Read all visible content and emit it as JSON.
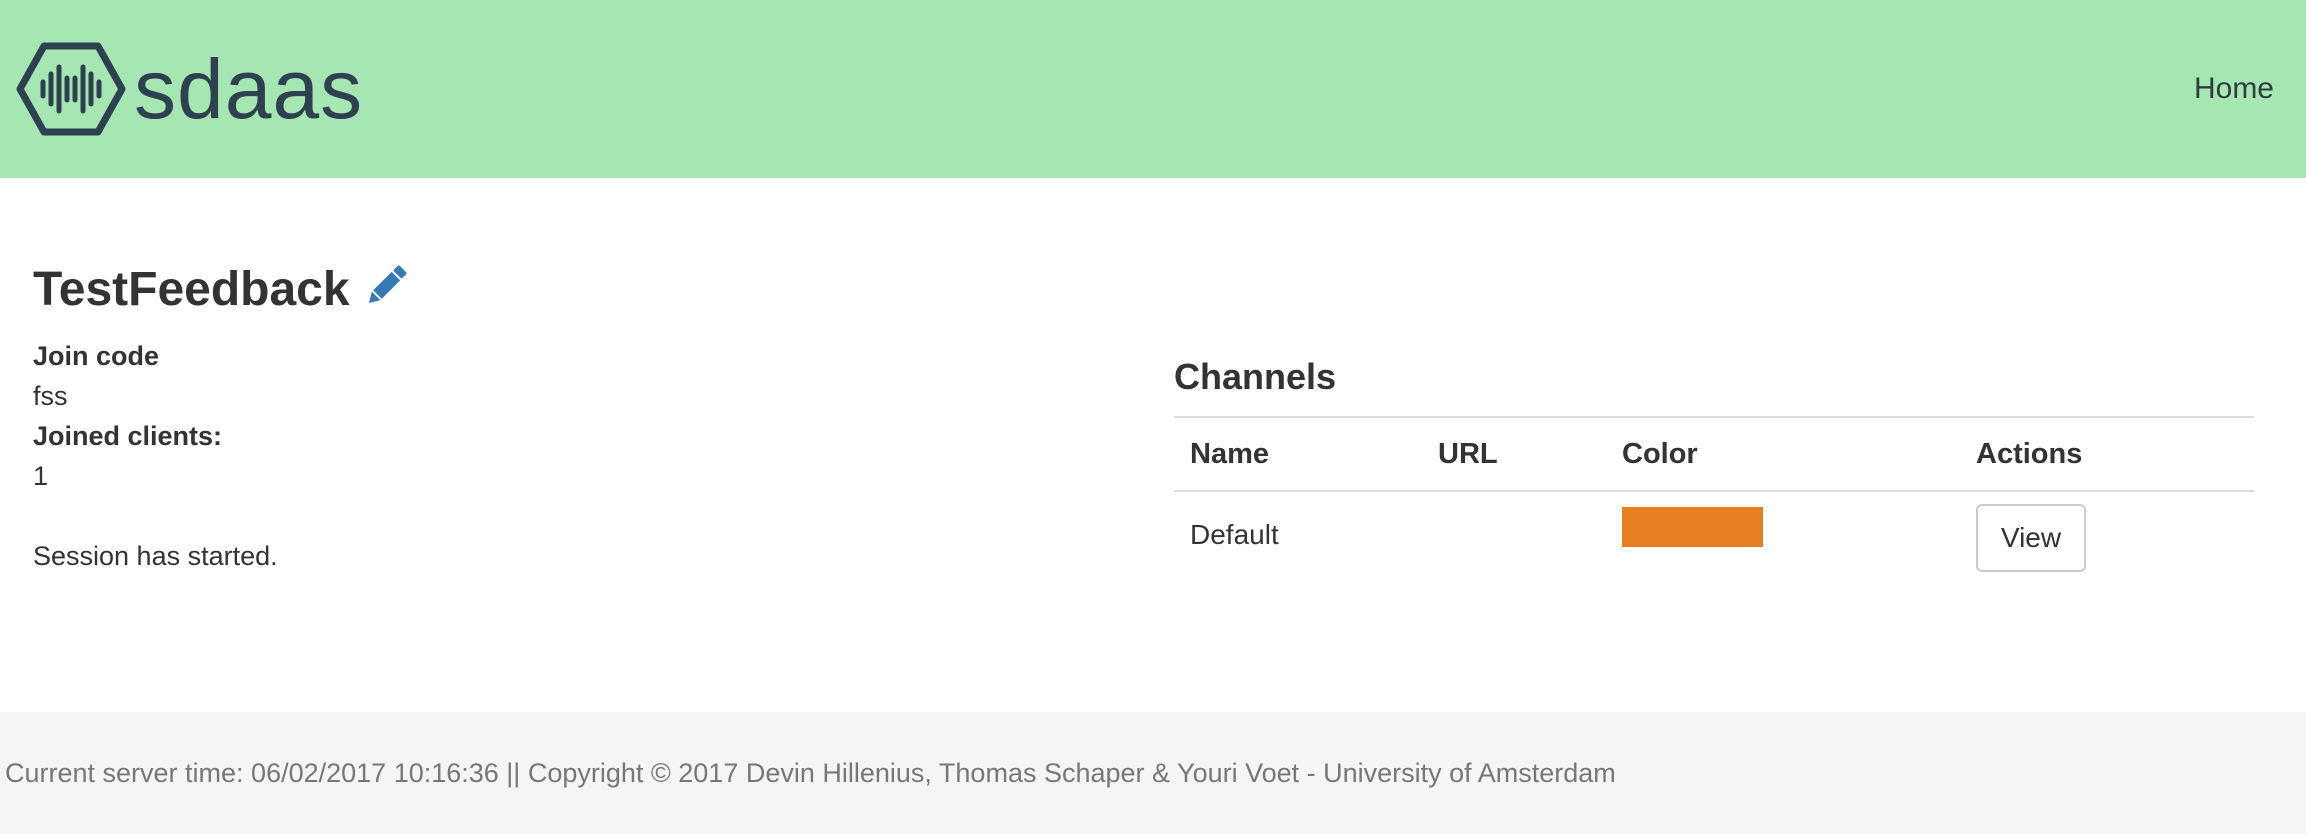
{
  "header": {
    "brand_name": "sdaas",
    "logo_icon": "soundwave-hexagon-icon",
    "nav_home_label": "Home",
    "background_color": "#a5e6b2"
  },
  "session": {
    "title": "TestFeedback",
    "edit_icon": "pencil-icon",
    "join_code_label": "Join code",
    "join_code_value": "fss",
    "joined_clients_label": "Joined clients:",
    "joined_clients_value": "1",
    "status_text": "Session has started."
  },
  "channels": {
    "heading": "Channels",
    "columns": [
      "Name",
      "URL",
      "Color",
      "Actions"
    ],
    "rows": [
      {
        "name": "Default",
        "url": "",
        "color": "#e67e22",
        "action_label": "View"
      }
    ]
  },
  "footer": {
    "text": "Current server time: 06/02/2017 10:16:36 || Copyright © 2017 Devin Hillenius, Thomas Schaper & Youri Voet - University of Amsterdam"
  }
}
